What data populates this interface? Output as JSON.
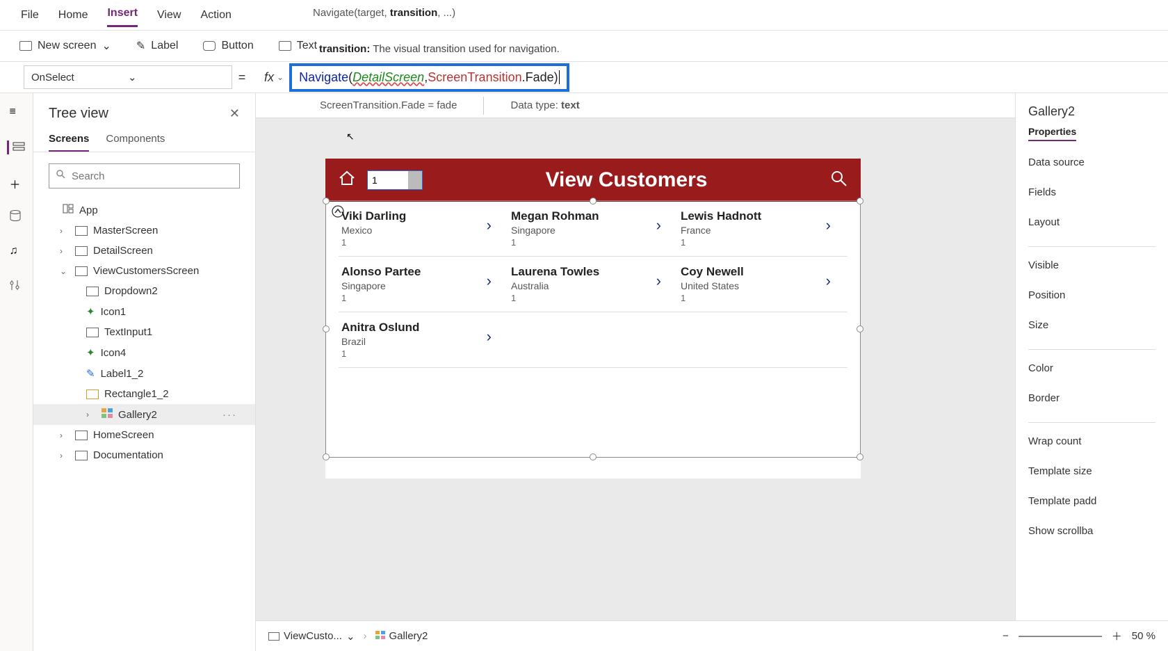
{
  "menu": {
    "file": "File",
    "home": "Home",
    "insert": "Insert",
    "view": "View",
    "action": "Action",
    "active": "Insert"
  },
  "signature": {
    "fn": "Navigate",
    "p1": "target,",
    "p2": "transition",
    "p3": ", ...)"
  },
  "tooltip_param": {
    "name": "transition:",
    "desc": "The visual transition used for navigation."
  },
  "ribbon": {
    "newScreen": "New screen",
    "label": "Label",
    "button": "Button",
    "text": "Text"
  },
  "formula": {
    "property": "OnSelect",
    "tokens": {
      "nav": "Navigate",
      "open": "(",
      "arg1": "DetailScreen",
      "comma": ",",
      "sp": " ",
      "trans": "ScreenTransition",
      "dot": ".",
      "fade": "Fade",
      "close": ")"
    }
  },
  "intelli": {
    "line1": "ScreenTransition.Fade  =  fade",
    "dt_label": "Data type:",
    "dt_value": "text"
  },
  "tree": {
    "title": "Tree view",
    "tabs": {
      "screens": "Screens",
      "components": "Components",
      "active": "Screens"
    },
    "search_placeholder": "Search",
    "app": "App",
    "items": [
      {
        "label": "MasterScreen"
      },
      {
        "label": "DetailScreen"
      },
      {
        "label": "ViewCustomersScreen",
        "expanded": true,
        "children": [
          {
            "label": "Dropdown2",
            "icon": "dd"
          },
          {
            "label": "Icon1",
            "icon": "ic"
          },
          {
            "label": "TextInput1",
            "icon": "ti"
          },
          {
            "label": "Icon4",
            "icon": "ic"
          },
          {
            "label": "Label1_2",
            "icon": "lbl"
          },
          {
            "label": "Rectangle1_2",
            "icon": "rect"
          },
          {
            "label": "Gallery2",
            "icon": "gal",
            "selected": true
          }
        ]
      },
      {
        "label": "HomeScreen"
      },
      {
        "label": "Documentation"
      }
    ]
  },
  "canvasApp": {
    "title": "View Customers",
    "dropdownValue": "1",
    "customers": [
      {
        "name": "Viki  Darling",
        "country": "Mexico",
        "n": "1"
      },
      {
        "name": "Megan  Rohman",
        "country": "Singapore",
        "n": "1"
      },
      {
        "name": "Lewis  Hadnott",
        "country": "France",
        "n": "1"
      },
      {
        "name": "Alonso  Partee",
        "country": "Singapore",
        "n": "1"
      },
      {
        "name": "Laurena  Towles",
        "country": "Australia",
        "n": "1"
      },
      {
        "name": "Coy  Newell",
        "country": "United States",
        "n": "1"
      },
      {
        "name": "Anitra  Oslund",
        "country": "Brazil",
        "n": "1"
      }
    ]
  },
  "props": {
    "title": "Gallery2",
    "tab": "Properties",
    "rows": [
      "Data source",
      "Fields",
      "Layout",
      "Visible",
      "Position",
      "Size",
      "Color",
      "Border",
      "Wrap count",
      "Template size",
      "Template padd",
      "Show scrollba"
    ]
  },
  "statusbar": {
    "screen": "ViewCusto...",
    "control": "Gallery2",
    "zoom": "50 %"
  }
}
